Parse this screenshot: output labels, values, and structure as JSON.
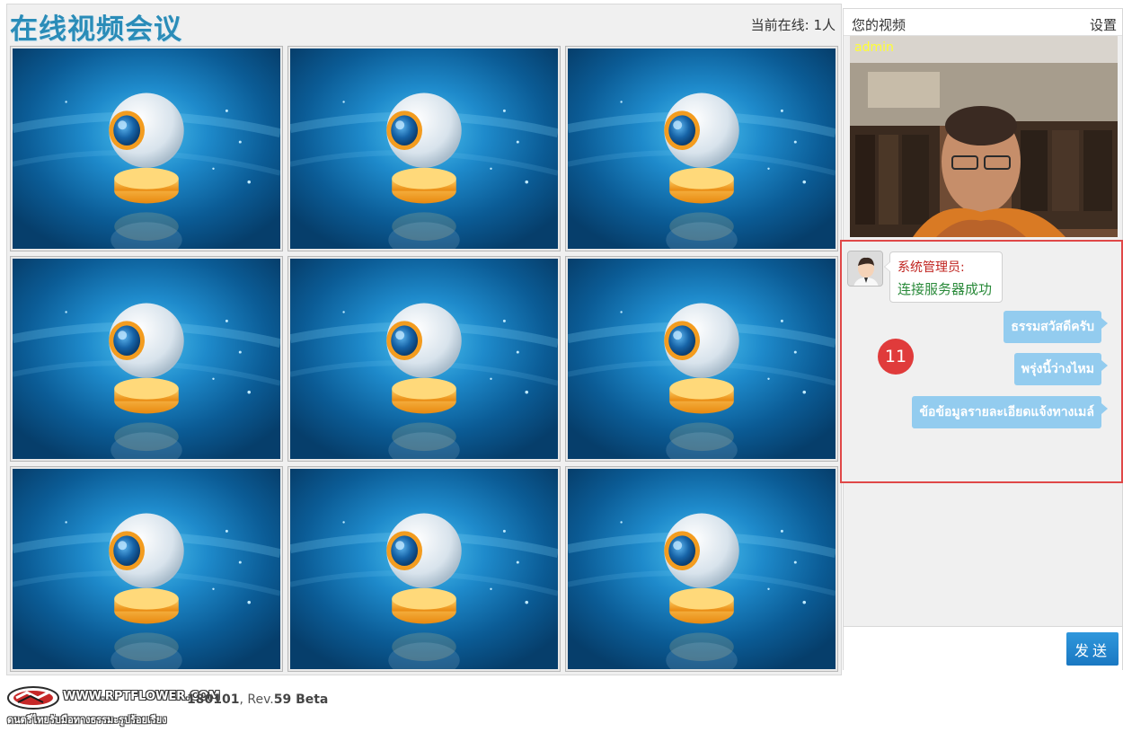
{
  "app": {
    "title": "在线视频会议",
    "online_label": "当前在线: 1人"
  },
  "video_grid": {
    "tiles": [
      {
        "icon": "webcam-icon"
      },
      {
        "icon": "webcam-icon"
      },
      {
        "icon": "webcam-icon"
      },
      {
        "icon": "webcam-icon"
      },
      {
        "icon": "webcam-icon"
      },
      {
        "icon": "webcam-icon"
      },
      {
        "icon": "webcam-icon"
      },
      {
        "icon": "webcam-icon"
      },
      {
        "icon": "webcam-icon"
      }
    ]
  },
  "side_panel": {
    "my_video_label": "您的视频",
    "settings_label": "设置",
    "user_name": "admin"
  },
  "chat": {
    "system_sender": "系统管理员:",
    "system_text": "连接服务器成功",
    "messages": [
      {
        "text": "ธรรมสวัสดีครับ"
      },
      {
        "text": "พรุ่งนี้ว่างไหม"
      },
      {
        "text": "ข้อข้อมูลรายละเอียดแจ้งทางเมล์"
      }
    ],
    "badge": "11",
    "input_placeholder": "",
    "send_label": "发送"
  },
  "footer": {
    "site": "WWW.RPTFLOWER.COM",
    "version_prefix": "180101",
    "version_rev_label": ", Rev.",
    "version_rev": "59 Beta",
    "subtitle": "ดนตรีไทยรับมือทางธรรมะรูปร้อยเรียง"
  },
  "colors": {
    "accent": "#2a8cb8",
    "chat_bubble": "#93ccef",
    "highlight_border": "#e04848",
    "badge": "#e03b3b",
    "send_button": "#1f86cf"
  }
}
